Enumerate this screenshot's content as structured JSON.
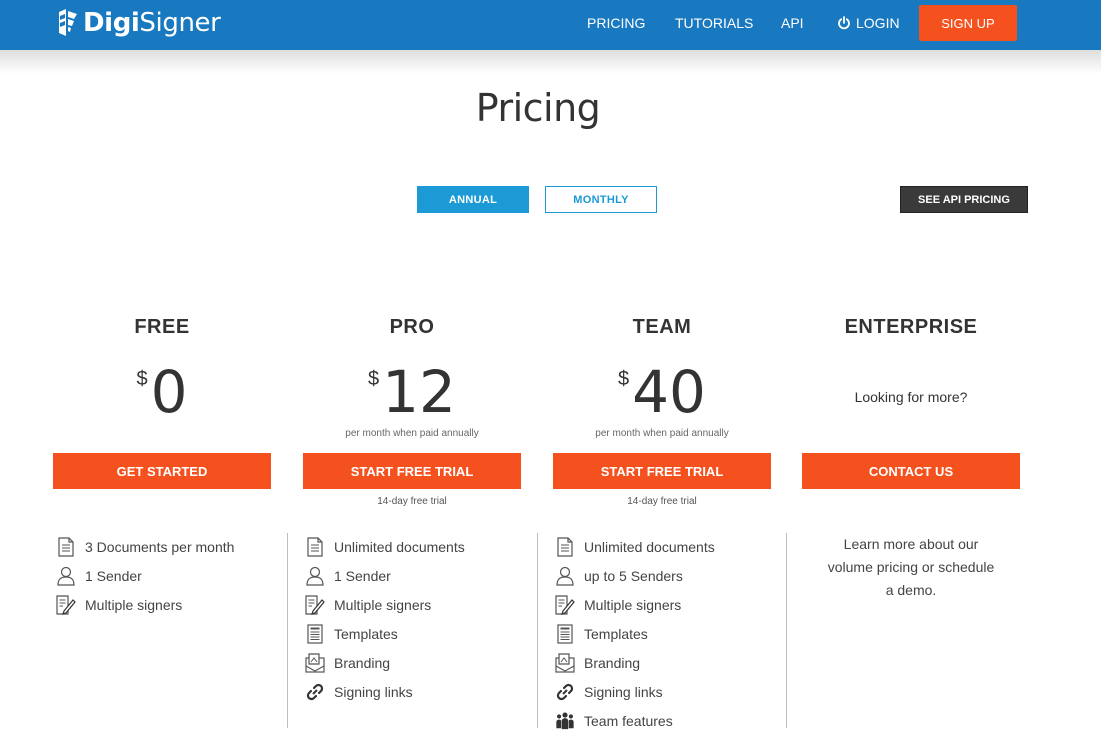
{
  "header": {
    "logo_bold": "Digi",
    "logo_regular": "Signer",
    "nav": {
      "pricing": "PRICING",
      "tutorials": "TUTORIALS",
      "api": "API",
      "login": "LOGIN",
      "signup": "SIGN UP"
    }
  },
  "page": {
    "title": "Pricing",
    "toggle_annual": "ANNUAL",
    "toggle_monthly": "MONTHLY",
    "selected_billing": "ANNUAL",
    "api_pricing": "SEE API PRICING"
  },
  "colors": {
    "header_blue": "#1878c0",
    "accent_orange": "#f4511e",
    "toggle_blue": "#1b9ad6",
    "dark_button": "#3a3a3a"
  },
  "plans": {
    "free": {
      "name": "FREE",
      "currency": "$",
      "price": "0",
      "cta": "GET STARTED",
      "features": [
        {
          "icon": "document-icon",
          "label": "3 Documents per month"
        },
        {
          "icon": "user-icon",
          "label": "1 Sender"
        },
        {
          "icon": "signers-icon",
          "label": "Multiple signers"
        }
      ]
    },
    "pro": {
      "name": "PRO",
      "currency": "$",
      "price": "12",
      "price_note": "per month when paid annually",
      "cta": "START FREE TRIAL",
      "trial_note": "14-day free trial",
      "features": [
        {
          "icon": "document-icon",
          "label": "Unlimited documents"
        },
        {
          "icon": "user-icon",
          "label": "1 Sender"
        },
        {
          "icon": "signers-icon",
          "label": "Multiple signers"
        },
        {
          "icon": "template-icon",
          "label": "Templates"
        },
        {
          "icon": "branding-icon",
          "label": "Branding"
        },
        {
          "icon": "link-icon",
          "label": "Signing links"
        }
      ]
    },
    "team": {
      "name": "TEAM",
      "currency": "$",
      "price": "40",
      "price_note": "per month when paid annually",
      "cta": "START FREE TRIAL",
      "trial_note": "14-day free trial",
      "features": [
        {
          "icon": "document-icon",
          "label": "Unlimited documents"
        },
        {
          "icon": "user-icon",
          "label": "up to 5 Senders"
        },
        {
          "icon": "signers-icon",
          "label": "Multiple signers"
        },
        {
          "icon": "template-icon",
          "label": "Templates"
        },
        {
          "icon": "branding-icon",
          "label": "Branding"
        },
        {
          "icon": "link-icon",
          "label": "Signing links"
        },
        {
          "icon": "team-icon",
          "label": "Team features"
        }
      ]
    },
    "enterprise": {
      "name": "ENTERPRISE",
      "tagline": "Looking for more?",
      "cta": "CONTACT US",
      "description_lines": [
        "Learn more about our",
        "volume pricing or schedule",
        "a demo."
      ]
    }
  }
}
